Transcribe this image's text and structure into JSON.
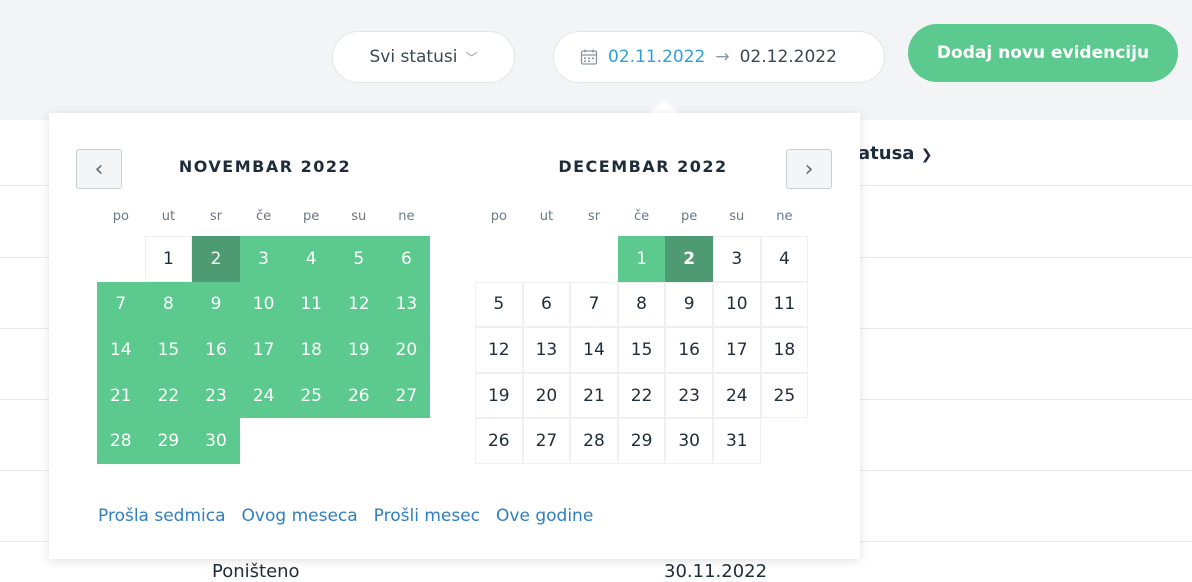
{
  "toolbar": {
    "status_filter": "Svi statusi",
    "date_from": "02.11.2022",
    "date_arrow": "→",
    "date_to": "02.12.2022",
    "add_button": "Dodaj novu evidenciju"
  },
  "background": {
    "column_header": "atusa",
    "row_partial_left": "Poništeno",
    "row_partial_right": "30.11.2022"
  },
  "calendar": {
    "prev_label": "‹",
    "next_label": "›",
    "weekdays": [
      "po",
      "ut",
      "sr",
      "če",
      "pe",
      "su",
      "ne"
    ],
    "months": [
      {
        "title": "NOVEMBAR 2022",
        "leading_blanks": 1,
        "days": 30,
        "range_from": 2,
        "range_to": 30,
        "endpoint": 2
      },
      {
        "title": "DECEMBAR 2022",
        "leading_blanks": 3,
        "days": 31,
        "range_from": 1,
        "range_to": 2,
        "endpoint": 2
      }
    ],
    "quick_links": [
      "Prošla sedmica",
      "Ovog meseca",
      "Prošli mesec",
      "Ove godine"
    ]
  },
  "colors": {
    "accent_green": "#5cc98f",
    "endpoint_green": "#4e9b73",
    "link_blue": "#2f7fc2"
  }
}
